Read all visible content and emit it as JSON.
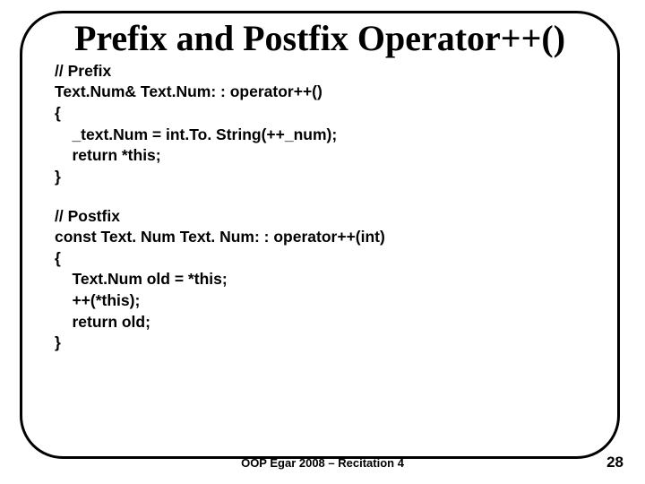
{
  "title": "Prefix and Postfix Operator++()",
  "code": {
    "prefix": {
      "l1": "// Prefix",
      "l2": "Text.Num& Text.Num: : operator++()",
      "l3": "{",
      "l4": "    _text.Num = int.To. String(++_num);",
      "l5": "    return *this;",
      "l6": "}"
    },
    "postfix": {
      "l1": "// Postfix",
      "l2": "const Text. Num Text. Num: : operator++(int)",
      "l3": "{",
      "l4": "    Text.Num old = *this;",
      "l5": "    ++(*this);",
      "l6": "    return old;",
      "l7": "}"
    }
  },
  "footer": "OOP Egar 2008 – Recitation 4",
  "page": "28"
}
